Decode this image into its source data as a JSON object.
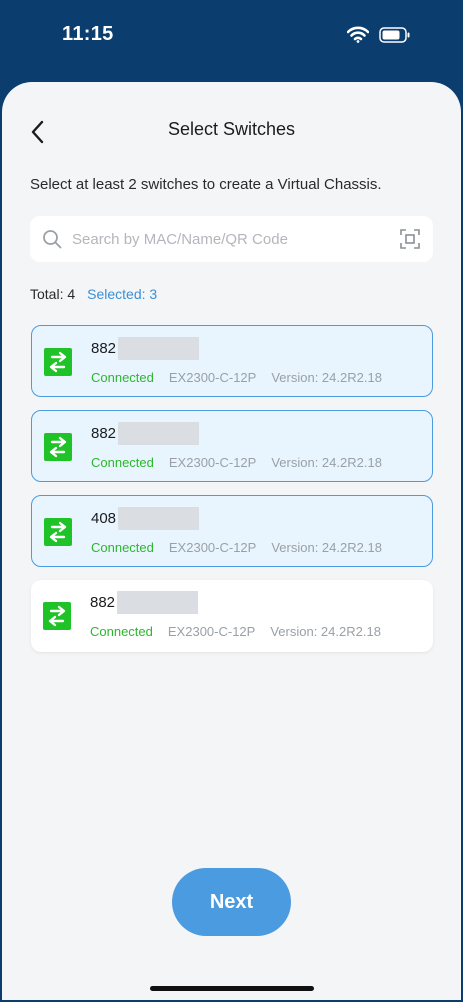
{
  "status_bar": {
    "time": "11:15"
  },
  "nav": {
    "title": "Select Switches"
  },
  "instruction": "Select at least 2 switches to create a Virtual Chassis.",
  "search": {
    "placeholder": "Search by MAC/Name/QR Code",
    "value": ""
  },
  "counts": {
    "total": "Total: 4",
    "selected": "Selected: 3"
  },
  "switches": [
    {
      "name": "882",
      "status": "Connected",
      "model": "EX2300-C-12P",
      "version": "Version: 24.2R2.18",
      "selected": true
    },
    {
      "name": "882",
      "status": "Connected",
      "model": "EX2300-C-12P",
      "version": "Version: 24.2R2.18",
      "selected": true
    },
    {
      "name": "408",
      "status": "Connected",
      "model": "EX2300-C-12P",
      "version": "Version: 24.2R2.18",
      "selected": true
    },
    {
      "name": "882",
      "status": "Connected",
      "model": "EX2300-C-12P",
      "version": "Version: 24.2R2.18",
      "selected": false
    }
  ],
  "next_label": "Next",
  "icons": {
    "back": "chevron-left-icon",
    "search": "search-icon",
    "scan": "scan-icon",
    "switch": "switch-arrows-icon",
    "wifi": "wifi-icon",
    "battery": "battery-icon"
  },
  "colors": {
    "header": "#0b3d6e",
    "accent": "#4a9be0",
    "selected_bg": "#e8f5fe",
    "connected": "#2db72d",
    "switch_icon": "#1fc227"
  }
}
